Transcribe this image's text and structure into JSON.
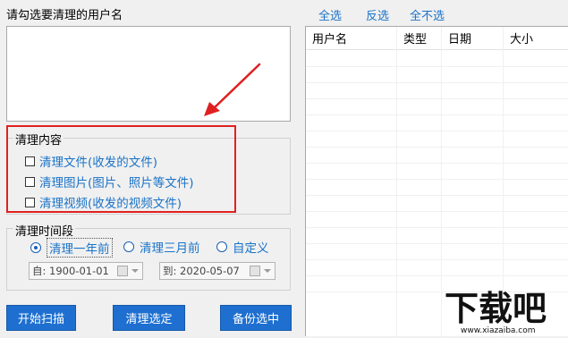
{
  "user_section": {
    "title": "请勾选要清理的用户名"
  },
  "selection_links": {
    "select_all": "全选",
    "invert": "反选",
    "select_none": "全不选"
  },
  "clean_content": {
    "title": "清理内容",
    "options": [
      {
        "label": "清理文件(收发的文件)",
        "checked": false
      },
      {
        "label": "清理图片(图片、照片等文件)",
        "checked": false
      },
      {
        "label": "清理视频(收发的视频文件)",
        "checked": false
      }
    ],
    "highlight_color": "#e02020"
  },
  "time_range": {
    "title": "清理时间段",
    "options": [
      {
        "label": "清理一年前",
        "selected": true
      },
      {
        "label": "清理三月前",
        "selected": false
      },
      {
        "label": "自定义",
        "selected": false
      }
    ],
    "from": {
      "prefix": "自:",
      "value": "1900-01-01"
    },
    "to": {
      "prefix": "到:",
      "value": "2020-05-07"
    }
  },
  "buttons": {
    "scan": "开始扫描",
    "clean_selected": "清理选定",
    "backup_selected": "备份选中"
  },
  "file_table": {
    "columns": [
      "用户名",
      "类型",
      "日期",
      "大小"
    ],
    "rows": []
  },
  "watermark": {
    "text": "下载吧",
    "url": "www.xiazaiba.com"
  },
  "colors": {
    "accent": "#1e6fd0",
    "link": "#1a73c8",
    "annotation": "#e02020"
  }
}
